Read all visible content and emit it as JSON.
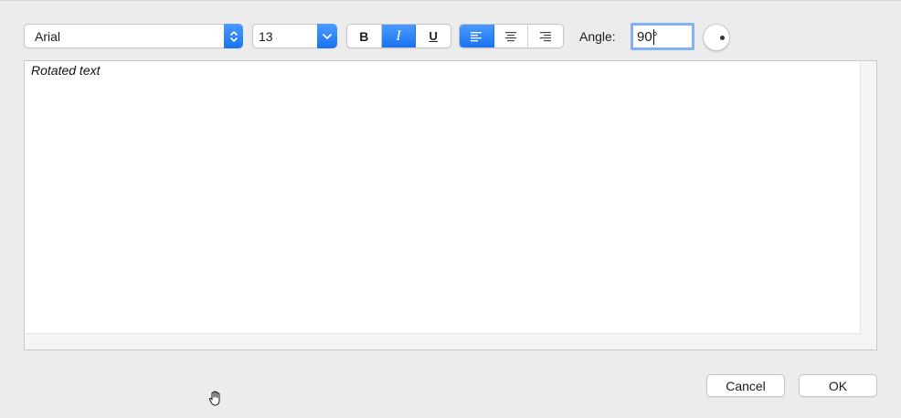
{
  "toolbar": {
    "font_family": "Arial",
    "font_size": "13",
    "bold_label": "B",
    "italic_label": "I",
    "underline_label": "U",
    "italic_active": true,
    "alignment": "left",
    "angle_label": "Angle:",
    "angle_value": "90°"
  },
  "editor": {
    "text": "Rotated text"
  },
  "buttons": {
    "cancel": "Cancel",
    "ok": "OK"
  },
  "colors": {
    "accent": "#1a73f0",
    "focus_ring": "#7eb1f5"
  },
  "icons": {
    "font_stepper": "up-down-chevron-icon",
    "size_dropdown": "chevron-down-icon",
    "align_left": "align-left-icon",
    "align_center": "align-center-icon",
    "align_right": "align-right-icon",
    "angle_knob": "rotation-knob-icon",
    "cursor": "hand-cursor-icon"
  }
}
